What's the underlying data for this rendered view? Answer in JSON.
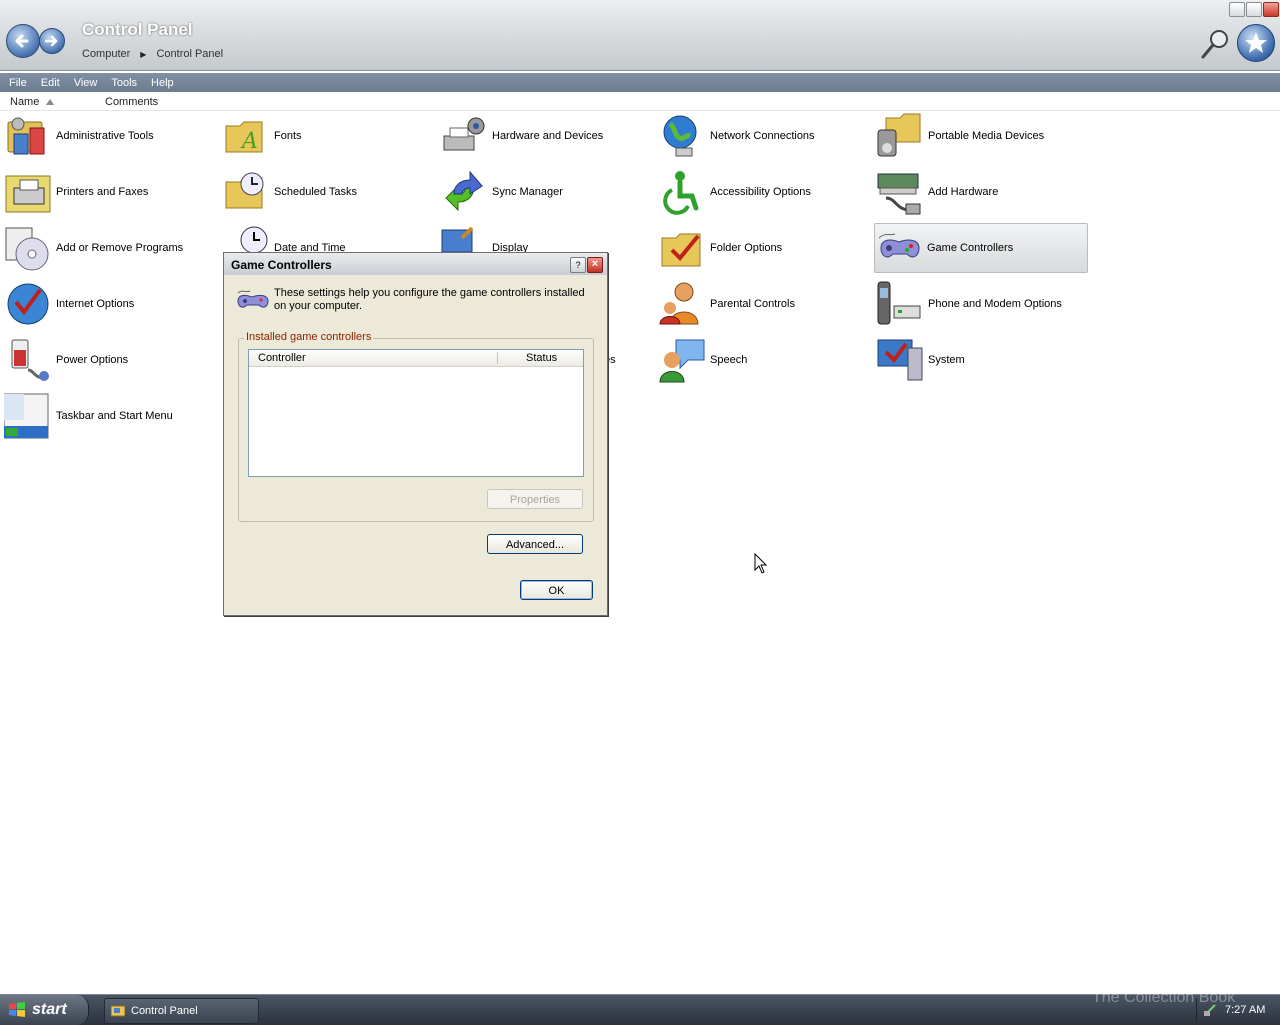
{
  "window": {
    "title": "Control Panel",
    "breadcrumb": [
      "Computer",
      "Control Panel"
    ]
  },
  "menu": [
    "File",
    "Edit",
    "View",
    "Tools",
    "Help"
  ],
  "columns": {
    "name": "Name",
    "comments": "Comments"
  },
  "items": [
    {
      "label": "Administrative Tools",
      "icon": "administrative-tools-icon"
    },
    {
      "label": "Fonts",
      "icon": "fonts-folder-icon"
    },
    {
      "label": "Hardware and Devices",
      "icon": "hardware-devices-icon"
    },
    {
      "label": "Network Connections",
      "icon": "network-globe-icon"
    },
    {
      "label": "Portable Media Devices",
      "icon": "portable-media-icon"
    },
    {
      "label": "Printers and Faxes",
      "icon": "printer-icon"
    },
    {
      "label": "Scheduled Tasks",
      "icon": "scheduled-tasks-icon"
    },
    {
      "label": "Sync Manager",
      "icon": "sync-arrows-icon"
    },
    {
      "label": "Accessibility Options",
      "icon": "accessibility-icon"
    },
    {
      "label": "Add Hardware",
      "icon": "add-hardware-icon"
    },
    {
      "label": "Add or Remove Programs",
      "icon": "add-remove-programs-icon"
    },
    {
      "label": "Date and Time",
      "icon": "clock-icon"
    },
    {
      "label": "Display",
      "icon": "display-icon"
    },
    {
      "label": "Folder Options",
      "icon": "folder-options-icon"
    },
    {
      "label": "Game Controllers",
      "icon": "gamepad-icon"
    },
    {
      "label": "Internet Options",
      "icon": "internet-options-icon"
    },
    {
      "label": "Parental Controls",
      "icon": "parental-controls-icon"
    },
    {
      "label": "Phone and Modem Options",
      "icon": "phone-modem-icon"
    },
    {
      "label": "Power Options",
      "icon": "power-options-icon"
    },
    {
      "label": "es",
      "icon": ""
    },
    {
      "label": "Speech",
      "icon": "speech-icon"
    },
    {
      "label": "System",
      "icon": "system-icon"
    },
    {
      "label": "Taskbar and Start Menu",
      "icon": "taskbar-start-menu-icon"
    }
  ],
  "dialog": {
    "title": "Game Controllers",
    "help": "?",
    "close": "×",
    "description": "These settings help you configure the game controllers installed on your computer.",
    "group_label": "Installed game controllers",
    "columns": {
      "controller": "Controller",
      "status": "Status"
    },
    "properties": "Properties",
    "advanced": "Advanced...",
    "ok": "OK"
  },
  "taskbar": {
    "start": "start",
    "task": "Control Panel",
    "clock": "7:27 AM",
    "watermark": "The Collection Book"
  },
  "colors": {
    "menubar": "#6b7b90",
    "group_label": "#8c2200",
    "selection": "#d8dadc"
  }
}
